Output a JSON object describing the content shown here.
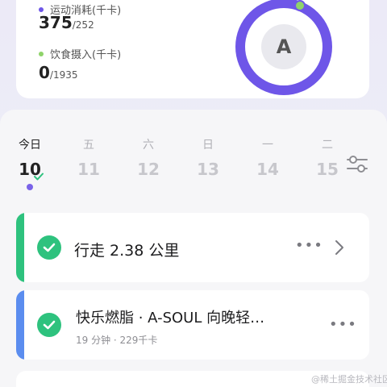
{
  "summary": {
    "exercise": {
      "label": "运动消耗(千卡)",
      "value": "375",
      "target": "/252",
      "dot_color": "#6e56e8"
    },
    "diet": {
      "label": "饮食摄入(千卡)",
      "value": "0",
      "target": "/1935",
      "dot_color": "#8fd36a"
    },
    "badge": {
      "letter": "A",
      "ring_color": "#6e56e8"
    }
  },
  "week": {
    "days": [
      {
        "weekday": "今日",
        "date": "10",
        "active": true
      },
      {
        "weekday": "五",
        "date": "11",
        "active": false
      },
      {
        "weekday": "六",
        "date": "12",
        "active": false
      },
      {
        "weekday": "日",
        "date": "13",
        "active": false
      },
      {
        "weekday": "一",
        "date": "14",
        "active": false
      },
      {
        "weekday": "二",
        "date": "15",
        "active": false
      }
    ],
    "filter_icon": "sliders-icon"
  },
  "activities": [
    {
      "title": "行走 2.38 公里",
      "accent_color": "#2ec27e",
      "more": "•••",
      "has_chevron": true
    },
    {
      "title": "快乐燃脂 · A-SOUL 向晚轻…",
      "subtitle": "19 分钟 · 229千卡",
      "accent_color": "#5b8def",
      "more": "•••"
    }
  ],
  "watermark": "@稀土掘金技术社区"
}
